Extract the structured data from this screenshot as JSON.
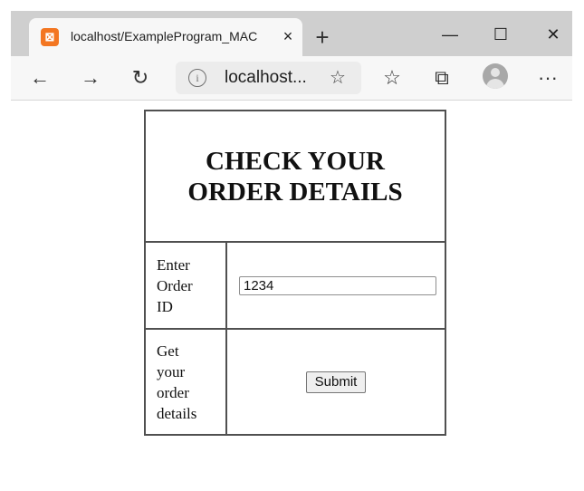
{
  "browser": {
    "tab": {
      "favicon_glyph": "⊠",
      "favicon_color": "#f37621",
      "title": "localhost/ExampleProgram_MAC",
      "close_label": "×"
    },
    "new_tab_label": "+",
    "window_controls": {
      "minimize": "—",
      "maximize": "☐",
      "close": "✕"
    },
    "toolbar": {
      "back": "←",
      "forward": "→",
      "refresh": "↻",
      "address_info": "i",
      "address_text": "localhost...",
      "add_favorite": "☆",
      "favorites": "☆",
      "collections": "⧉",
      "more": "···"
    }
  },
  "page": {
    "heading_line1": "CHECK YOUR",
    "heading_line2": "ORDER DETAILS",
    "order_id_label_lines": [
      "Enter",
      "Order",
      "ID"
    ],
    "order_id_value": "1234",
    "get_details_label_lines": [
      "Get",
      "your",
      "order",
      "details"
    ],
    "submit_label": "Submit"
  }
}
